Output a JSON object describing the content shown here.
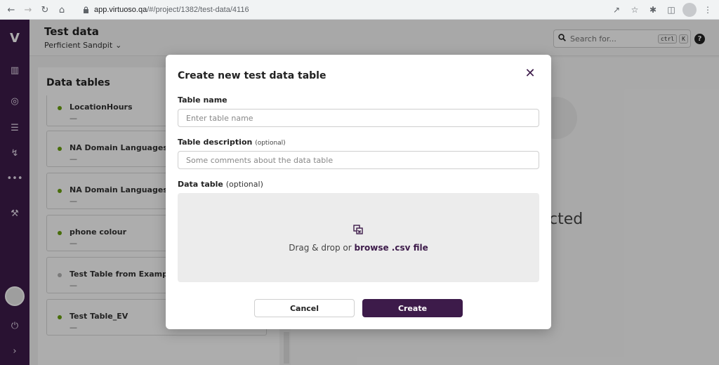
{
  "browser": {
    "url_host": "app.virtuoso.qa",
    "url_path": "/#/project/1382/test-data/4116"
  },
  "header": {
    "title": "Test data",
    "project": "Perficient Sandpit",
    "search_placeholder": "Search for...",
    "shortcut_ctrl": "ctrl",
    "shortcut_key": "K",
    "help": "?"
  },
  "panel": {
    "title": "Data tables",
    "items": [
      {
        "name": "LocationHours",
        "description": "—",
        "status_color": "#6aa10f"
      },
      {
        "name": "NA Domain Languages",
        "description": "—",
        "status_color": "#6aa10f"
      },
      {
        "name": "NA Domain Languages Alan",
        "description": "—",
        "status_color": "#6aa10f"
      },
      {
        "name": "phone colour",
        "description": "—",
        "status_color": "#6aa10f"
      },
      {
        "name": "Test Table from Example",
        "description": "—",
        "status_color": "#b5b5b5"
      },
      {
        "name": "Test Table_EV",
        "description": "—",
        "status_color": "#6aa10f"
      }
    ]
  },
  "right_text": "cted",
  "modal": {
    "title": "Create new test data table",
    "table_name_label": "Table name",
    "table_name_placeholder": "Enter table name",
    "table_desc_label": "Table description",
    "table_desc_optional": "(optional)",
    "table_desc_placeholder": "Some comments about the data table",
    "data_table_label": "Data table",
    "data_table_optional": "(optional)",
    "drop_text": "Drag & drop or ",
    "drop_link": "browse .csv file",
    "cancel_label": "Cancel",
    "create_label": "Create"
  },
  "colors": {
    "sidebar": "#3d1b4a",
    "accent": "#3d1b4a",
    "status_green": "#6aa10f",
    "status_grey": "#b5b5b5"
  }
}
